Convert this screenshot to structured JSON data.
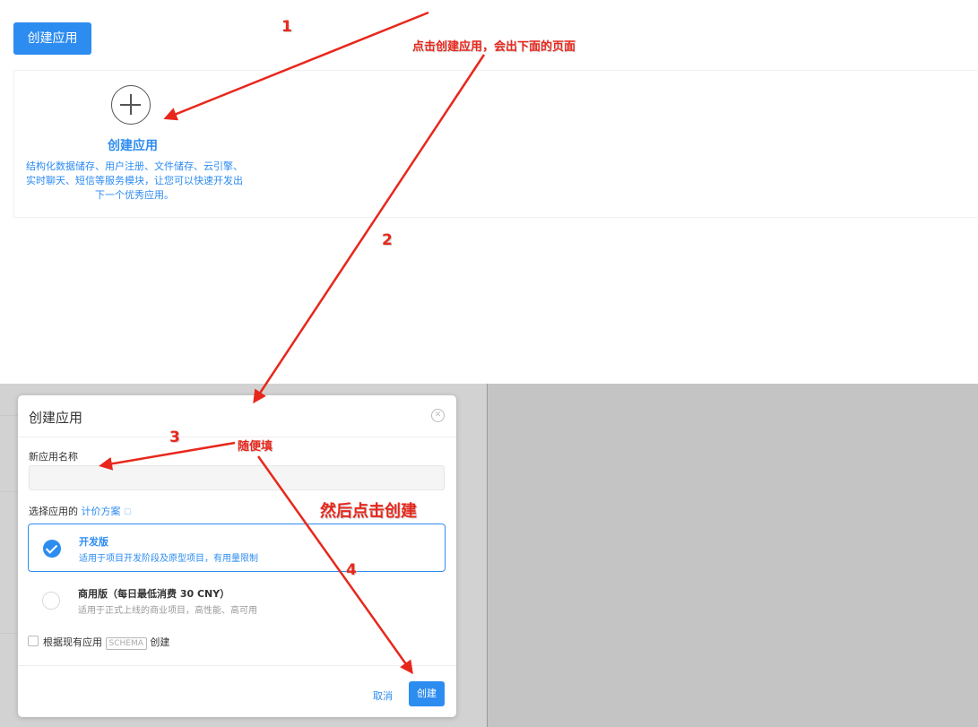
{
  "page": {
    "create_button_label": "创建应用",
    "card": {
      "icon": "plus-circle-icon",
      "title": "创建应用",
      "description": "结构化数据储存、用户注册、文件储存、云引擎、实时聊天、短信等服务模块，让您可以快速开发出下一个优秀应用。"
    }
  },
  "modal": {
    "title": "创建应用",
    "close_icon": "close-circle-icon",
    "name_label": "新应用名称",
    "name_value": "",
    "plan_label": "选择应用的",
    "plan_link": "计价方案",
    "plans": [
      {
        "title": "开发版",
        "desc": "适用于项目开发阶段及原型项目，有用量限制",
        "selected": true
      },
      {
        "title": "商用版（每日最低消费 30 CNY）",
        "desc": "适用于正式上线的商业项目，高性能、高可用",
        "selected": false
      }
    ],
    "schema_checkbox": {
      "prefix": "根据现有应用",
      "tag": "SCHEMA",
      "suffix": "创建",
      "checked": false
    },
    "cancel_label": "取消",
    "create_label": "创建"
  },
  "annotations": {
    "step1": "1",
    "note1": "点击创建应用，会出下面的页面",
    "step2": "2",
    "step3": "3",
    "note3": "随便填",
    "note_create": "然后点击创建",
    "step4": "4",
    "color": "#e8271c"
  },
  "colors": {
    "accent": "#2d8cf0",
    "overlay": "#c4c4c4"
  }
}
